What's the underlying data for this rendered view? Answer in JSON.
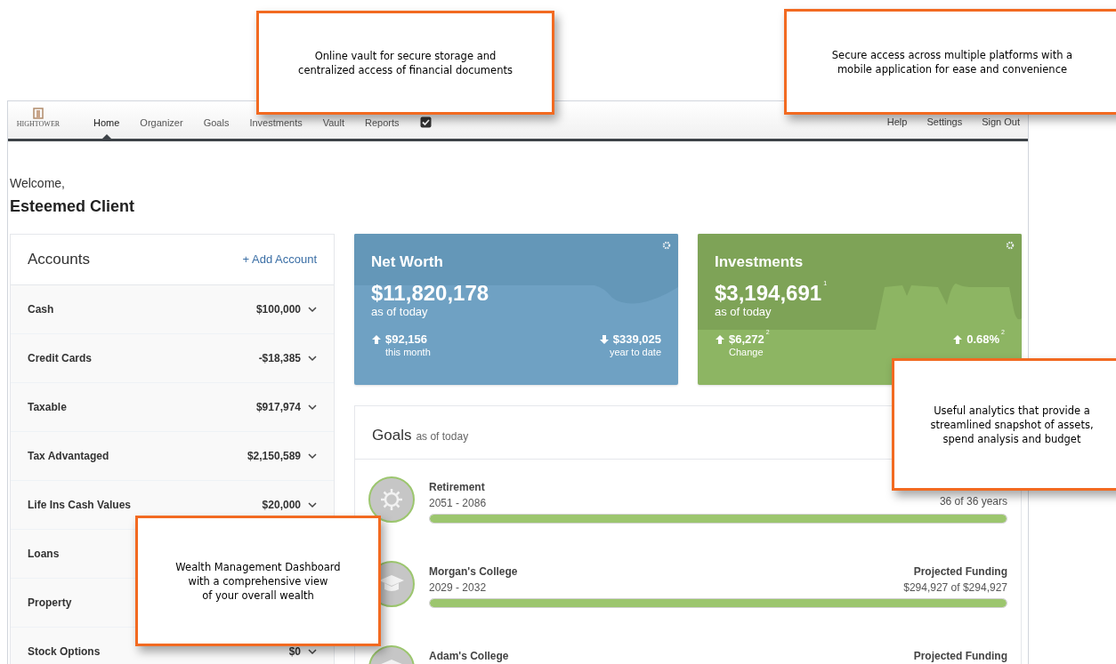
{
  "nav": {
    "logo": "HIGHTOWER",
    "items": [
      {
        "label": "Home",
        "selected": true
      },
      {
        "label": "Organizer",
        "selected": false
      },
      {
        "label": "Goals",
        "selected": false
      },
      {
        "label": "Investments",
        "selected": false
      },
      {
        "label": "Vault",
        "selected": false
      },
      {
        "label": "Reports",
        "selected": false
      }
    ],
    "right_items": [
      "Help",
      "Settings",
      "Sign Out"
    ]
  },
  "welcome": {
    "greeting": "Welcome,",
    "name": "Esteemed Client"
  },
  "accounts": {
    "title": "Accounts",
    "add_label": "+ Add Account",
    "rows": [
      {
        "label": "Cash",
        "value": "$100,000"
      },
      {
        "label": "Credit Cards",
        "value": "-$18,385"
      },
      {
        "label": "Taxable",
        "value": "$917,974"
      },
      {
        "label": "Tax Advantaged",
        "value": "$2,150,589"
      },
      {
        "label": "Life Ins Cash Values",
        "value": "$20,000"
      },
      {
        "label": "Loans"
      },
      {
        "label": "Property"
      },
      {
        "label": "Stock Options",
        "value": "$0"
      }
    ]
  },
  "cards": [
    {
      "kind": "networth",
      "title": "Net Worth",
      "value": "$11,820,178",
      "subtitle": "as of today",
      "left_value": "$92,156",
      "left_caption": "this month",
      "left_rising": true,
      "right_value": "$339,025",
      "right_caption": "year to date",
      "right_rising": false
    },
    {
      "kind": "investments",
      "title": "Investments",
      "value": "$3,194,691$^{1}$",
      "subtitle": "as of today",
      "left_value": "$6,272$^{2}$",
      "left_caption": "Change",
      "left_rising": true,
      "right_value": "0.68%$^{2}$",
      "right_rising": true
    }
  ],
  "goals": {
    "title": "Goals",
    "subtitle": "as of today",
    "items": [
      {
        "kind": "gear",
        "name": "Retirement",
        "years": "2051 - 2086",
        "right_value": "36 of 36 years",
        "level": 1
      },
      {
        "kind": "cap",
        "name": "Morgan's College",
        "years": "2029 - 2032",
        "right_label": "Projected Funding",
        "right_value": "$294,927 of $294,927",
        "level": 1
      },
      {
        "kind": "cap",
        "name": "Adam's College",
        "right_label": "Projected Funding"
      }
    ]
  },
  "callouts": [
    {
      "lines": [
        "Online vault for secure storage and",
        "centralized access of financial documents"
      ]
    },
    {
      "lines": [
        "Secure access across multiple platforms with a",
        "mobile application for ease and convenience"
      ]
    },
    {
      "lines": [
        "Useful analytics that provide a",
        "streamlined snapshot of assets,",
        "spend analysis and budget"
      ]
    },
    {
      "lines": [
        "Wealth Management Dashboard",
        "with a comprehensive view",
        "of your overall wealth"
      ]
    }
  ]
}
